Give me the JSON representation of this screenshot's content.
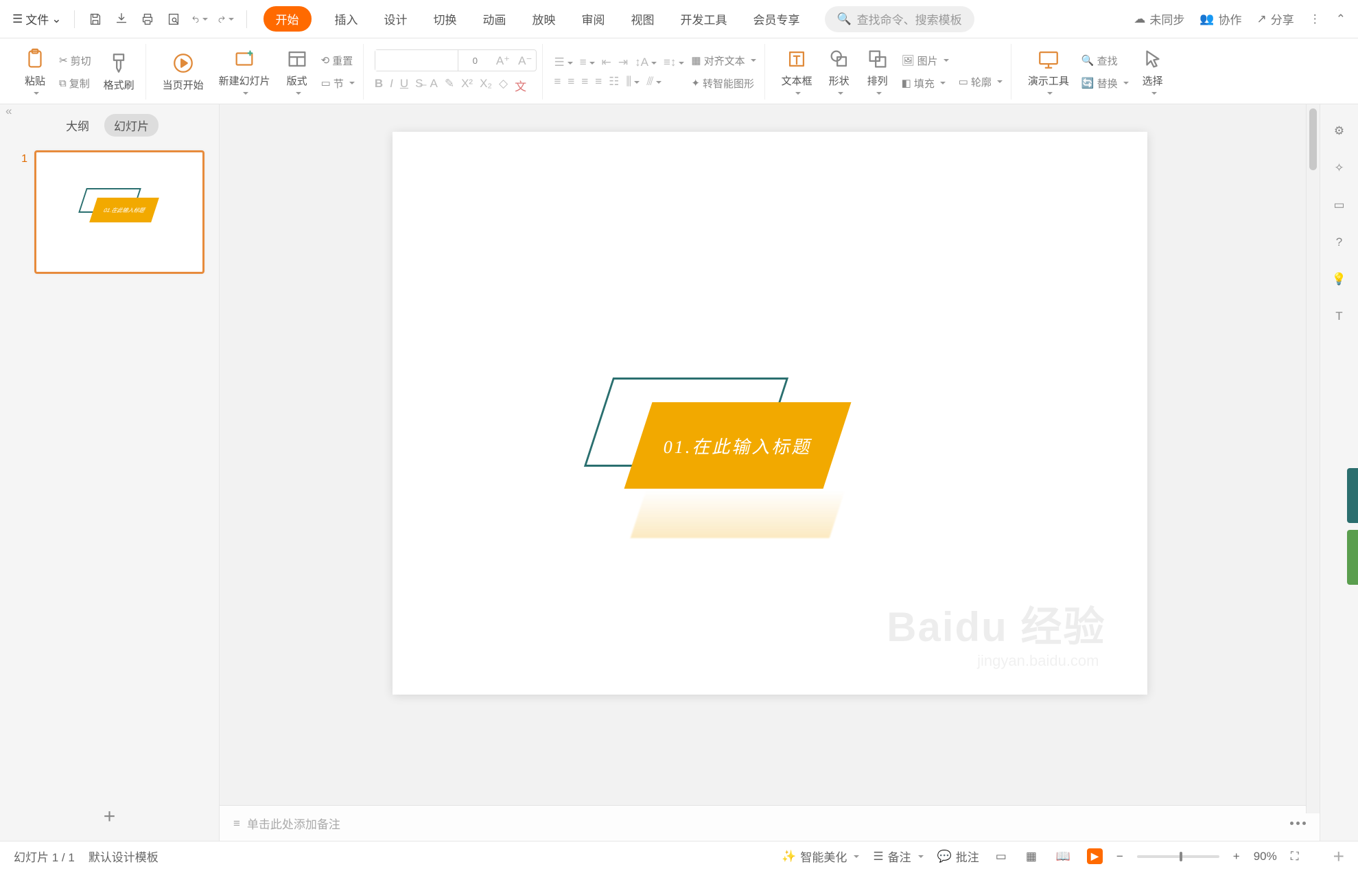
{
  "topbar": {
    "file_label": "文件",
    "sync": "未同步",
    "collab": "协作",
    "share": "分享"
  },
  "tabs": {
    "home": "开始",
    "insert": "插入",
    "design": "设计",
    "transition": "切换",
    "anim": "动画",
    "slideshow": "放映",
    "review": "审阅",
    "view": "视图",
    "devtools": "开发工具",
    "member": "会员专享"
  },
  "search": {
    "placeholder": "查找命令、搜索模板"
  },
  "ribbon": {
    "paste": "粘贴",
    "cut": "剪切",
    "copy": "复制",
    "format_painter": "格式刷",
    "from_current": "当页开始",
    "new_slide": "新建幻灯片",
    "layout": "版式",
    "section": "节",
    "reset": "重置",
    "font_name": "",
    "font_size": "0",
    "align_text": "对齐文本",
    "smart_art": "转智能图形",
    "textbox": "文本框",
    "shape": "形状",
    "arrange": "排列",
    "picture": "图片",
    "fill": "填充",
    "outline": "轮廓",
    "present_tools": "演示工具",
    "find": "查找",
    "replace": "替换",
    "select": "选择"
  },
  "sidepanel": {
    "outline": "大纲",
    "slides": "幻灯片",
    "idx1": "1"
  },
  "slide": {
    "title_text": "01.在此输入标题"
  },
  "notes": {
    "placeholder": "单击此处添加备注"
  },
  "status": {
    "counter": "幻灯片 1 / 1",
    "template": "默认设计模板",
    "smart_beautify": "智能美化",
    "notes": "备注",
    "comments": "批注",
    "zoom": "90%"
  },
  "watermark": {
    "logo": "Baidu 经验",
    "url": "jingyan.baidu.com"
  }
}
